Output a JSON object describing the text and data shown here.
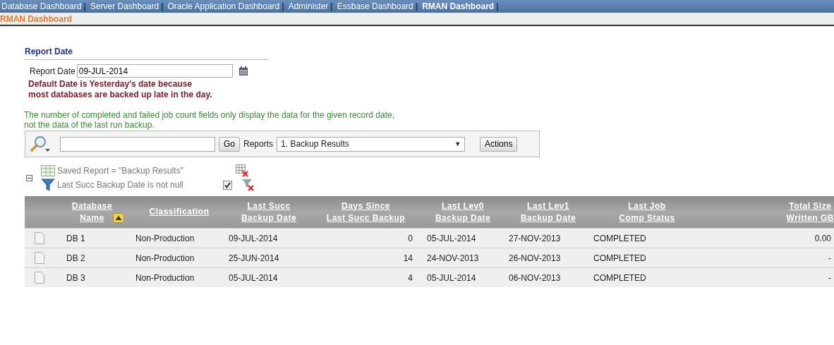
{
  "nav_tabs": [
    {
      "label": "Database Dashboard",
      "selected": false
    },
    {
      "label": "Server Dashboard",
      "selected": false
    },
    {
      "label": "Oracle Application Dashboard",
      "selected": false
    },
    {
      "label": "Administer",
      "selected": false
    },
    {
      "label": "Essbase Dashboard",
      "selected": false
    },
    {
      "label": "RMAN Dashboard",
      "selected": true
    }
  ],
  "separator": "|",
  "breadcrumb": "RMAN Dashboard",
  "report_date_region": {
    "title": "Report Date",
    "label": "Report Date",
    "value": "09-JUL-2014",
    "note_line_1": "Default Date is Yesterday's date because",
    "note_line_2": "most databases are backed up late in the day."
  },
  "info_line_1": "The number of completed and failed job count fields only display the data for the given record date,",
  "info_line_2": "not the data of the last run backup.",
  "search_bar": {
    "go": "Go",
    "reports_label": "Reports",
    "report_value": "1. Backup Results",
    "dropdown_arrow": "▼",
    "actions": "Actions"
  },
  "filters": {
    "expanded": true,
    "saved_report": "Saved Report = \"Backup Results\"",
    "filter": "Last Succ Backup Date is not null",
    "filter_checked": true
  },
  "table": {
    "columns": [
      {
        "line_1": "Database",
        "line_2": "Name",
        "sorted": true
      },
      {
        "line_1": "Classification",
        "sorted": false
      },
      {
        "line_1": "Last Succ",
        "line_2": "Backup Date",
        "sorted": false
      },
      {
        "line_1": "Days Since",
        "line_2": "Last Succ Backup",
        "sorted": false
      },
      {
        "line_1": "Last Lev0",
        "line_2": "Backup Date",
        "sorted": false
      },
      {
        "line_1": "Last Lev1",
        "line_2": "Backup Date",
        "sorted": false
      },
      {
        "line_1": "Last Job",
        "line_2": "Comp Status",
        "sorted": false
      },
      {
        "line_1": "Total Size",
        "line_2": "Written GB",
        "sorted": false
      }
    ],
    "rows": [
      [
        "DB 1",
        "Non-Production",
        "09-JUL-2014",
        "0",
        "05-JUL-2014",
        "27-NOV-2013",
        "COMPLETED",
        "0.00"
      ],
      [
        "DB 2",
        "Non-Production",
        "25-JUN-2014",
        "14",
        "24-NOV-2013",
        "26-NOV-2013",
        "COMPLETED",
        "-"
      ],
      [
        "DB 3",
        "Non-Production",
        "05-JUL-2014",
        "4",
        "05-JUL-2014",
        "06-NOV-2013",
        "COMPLETED",
        "-"
      ]
    ]
  }
}
